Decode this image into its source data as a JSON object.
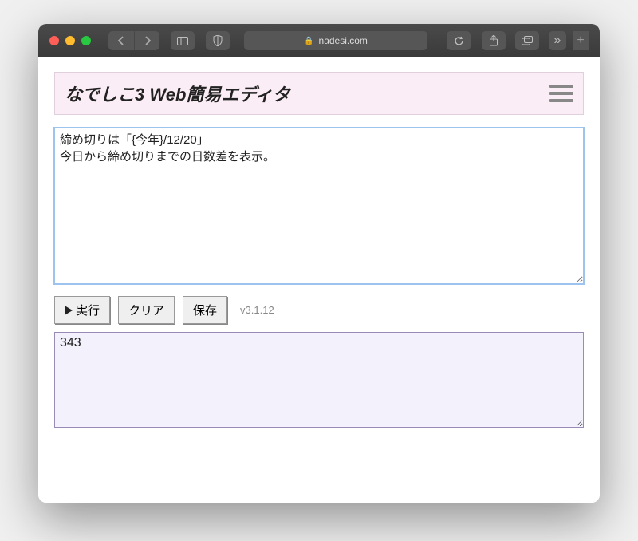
{
  "browser": {
    "domain": "nadesi.com"
  },
  "header": {
    "title": "なでしこ3 Web簡易エディタ"
  },
  "editor": {
    "code": "締め切りは「{今年}/12/20」\n今日から締め切りまでの日数差を表示。"
  },
  "toolbar": {
    "run_label": "実行",
    "clear_label": "クリア",
    "save_label": "保存"
  },
  "version": "v3.1.12",
  "output": {
    "value": "343"
  }
}
